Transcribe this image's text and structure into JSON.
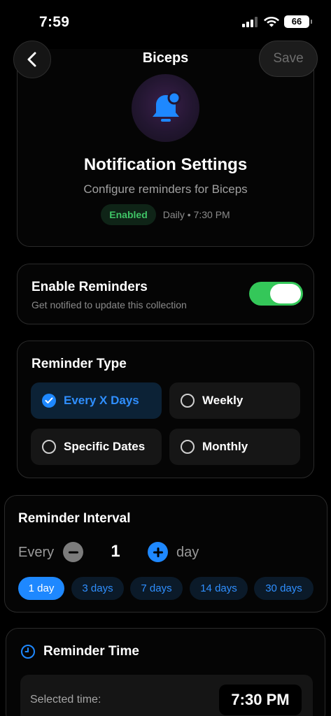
{
  "status_bar": {
    "time": "7:59",
    "battery": "66"
  },
  "nav": {
    "title": "Biceps",
    "save_label": "Save"
  },
  "header": {
    "title": "Notification Settings",
    "subtitle": "Configure reminders for Biceps",
    "badge": "Enabled",
    "schedule": "Daily • 7:30 PM"
  },
  "enable": {
    "title": "Enable Reminders",
    "subtitle": "Get notified to update this collection",
    "on": true
  },
  "reminder_type": {
    "title": "Reminder Type",
    "options": [
      {
        "label": "Every X Days",
        "selected": true
      },
      {
        "label": "Weekly",
        "selected": false
      },
      {
        "label": "Specific Dates",
        "selected": false
      },
      {
        "label": "Monthly",
        "selected": false
      }
    ]
  },
  "interval": {
    "title": "Reminder Interval",
    "every_label": "Every",
    "count": "1",
    "unit": "day",
    "presets": [
      {
        "label": "1 day",
        "active": true
      },
      {
        "label": "3 days",
        "active": false
      },
      {
        "label": "7 days",
        "active": false
      },
      {
        "label": "14 days",
        "active": false
      },
      {
        "label": "30 days",
        "active": false
      }
    ]
  },
  "time": {
    "title": "Reminder Time",
    "selected_label": "Selected time:",
    "value": "7:30 PM"
  },
  "colors": {
    "accent": "#1e88ff",
    "toggle_on": "#34c759",
    "enabled_text": "#3fc466",
    "background": "#000000"
  }
}
